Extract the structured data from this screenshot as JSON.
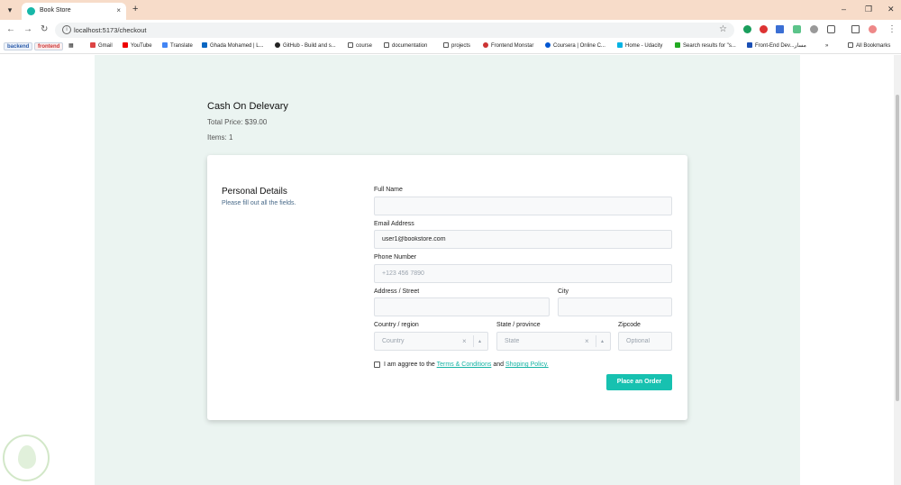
{
  "browser": {
    "tab_title": "Book Store",
    "tab_close": "×",
    "new_tab": "+",
    "menu_glyph": "▾",
    "url": "localhost:5173/checkout",
    "bookmarks": [
      "backend",
      "frontend",
      "Gmail",
      "YouTube",
      "Translate",
      "Ghada Mohamed | L...",
      "GitHub - Build and s...",
      "course",
      "documentation",
      "projects",
      "Frontend Monstar",
      "Coursera | Online C...",
      "Home - Udacity",
      "Search results for \"s...",
      "Front-End Dev...مسار",
      "»",
      "All Bookmarks"
    ]
  },
  "checkout": {
    "title": "Cash On Delevary",
    "total_price": "Total Price: $39.00",
    "items": "Items: 1"
  },
  "form": {
    "section_title": "Personal Details",
    "section_subtitle": "Please fill out all the fields.",
    "full_name_label": "Full Name",
    "full_name_value": "",
    "email_label": "Email Address",
    "email_value": "user1@bookstore.com",
    "phone_label": "Phone Number",
    "phone_placeholder": "+123 456 7890",
    "address_label": "Address / Street",
    "city_label": "City",
    "country_label": "Country / region",
    "country_placeholder": "Country",
    "state_label": "State / province",
    "state_placeholder": "State",
    "zipcode_label": "Zipcode",
    "zipcode_placeholder": "Optional",
    "terms_prefix": "I am aggree to the",
    "terms_link": "Terms & Conditions",
    "terms_and": "and",
    "policy_link": "Shoping Policy.",
    "submit_label": "Place an Order"
  },
  "colors": {
    "accent": "#17c1b0",
    "page_background": "#ebf4f1",
    "link": "#16b3a4"
  }
}
